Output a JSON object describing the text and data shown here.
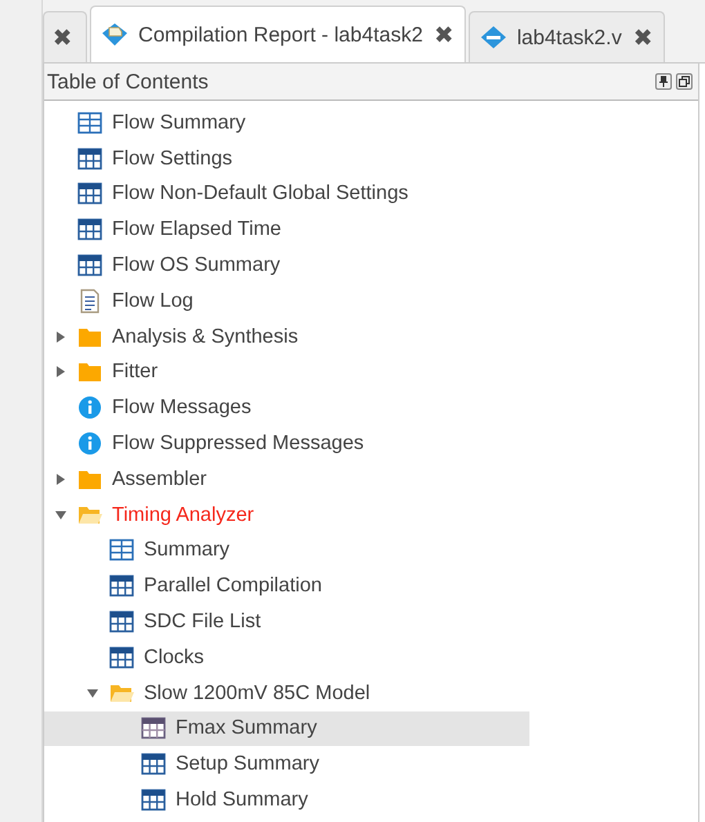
{
  "tabs": [
    {
      "close": "✖",
      "kind": "stub",
      "selected": false
    },
    {
      "label": "Compilation Report - lab4task2",
      "close": "✖",
      "kind": "report",
      "selected": true
    },
    {
      "label": "lab4task2.v",
      "close": "✖",
      "kind": "file",
      "selected": false
    }
  ],
  "panel": {
    "title": "Table of Contents"
  },
  "tree": [
    {
      "label": "Flow Summary",
      "kind": "summary",
      "selected": false,
      "alert": false
    },
    {
      "label": "Flow Settings",
      "kind": "table",
      "selected": false,
      "alert": false
    },
    {
      "label": "Flow Non-Default Global Settings",
      "kind": "table",
      "selected": false,
      "alert": false
    },
    {
      "label": "Flow Elapsed Time",
      "kind": "table",
      "selected": false,
      "alert": false
    },
    {
      "label": "Flow OS Summary",
      "kind": "table",
      "selected": false,
      "alert": false
    },
    {
      "label": "Flow Log",
      "kind": "log",
      "selected": false,
      "alert": false
    },
    {
      "label": "Analysis & Synthesis",
      "kind": "folder",
      "expanded": false,
      "selected": false,
      "alert": false
    },
    {
      "label": "Fitter",
      "kind": "folder",
      "expanded": false,
      "selected": false,
      "alert": false
    },
    {
      "label": "Flow Messages",
      "kind": "info",
      "selected": false,
      "alert": false
    },
    {
      "label": "Flow Suppressed Messages",
      "kind": "info",
      "selected": false,
      "alert": false
    },
    {
      "label": "Assembler",
      "kind": "folder",
      "expanded": false,
      "selected": false,
      "alert": false
    },
    {
      "label": "Timing Analyzer",
      "kind": "folder",
      "expanded": true,
      "selected": false,
      "alert": true,
      "children": [
        {
          "label": "Summary",
          "kind": "summary",
          "selected": false,
          "alert": false
        },
        {
          "label": "Parallel Compilation",
          "kind": "table",
          "selected": false,
          "alert": false
        },
        {
          "label": "SDC File List",
          "kind": "table",
          "selected": false,
          "alert": false
        },
        {
          "label": "Clocks",
          "kind": "table",
          "selected": false,
          "alert": false
        },
        {
          "label": "Slow 1200mV 85C Model",
          "kind": "folder",
          "expanded": true,
          "selected": false,
          "alert": false,
          "children": [
            {
              "label": "Fmax Summary",
              "kind": "table",
              "selected": true,
              "alert": false
            },
            {
              "label": "Setup Summary",
              "kind": "table",
              "selected": false,
              "alert": false
            },
            {
              "label": "Hold Summary",
              "kind": "table",
              "selected": false,
              "alert": false
            }
          ]
        }
      ]
    }
  ]
}
